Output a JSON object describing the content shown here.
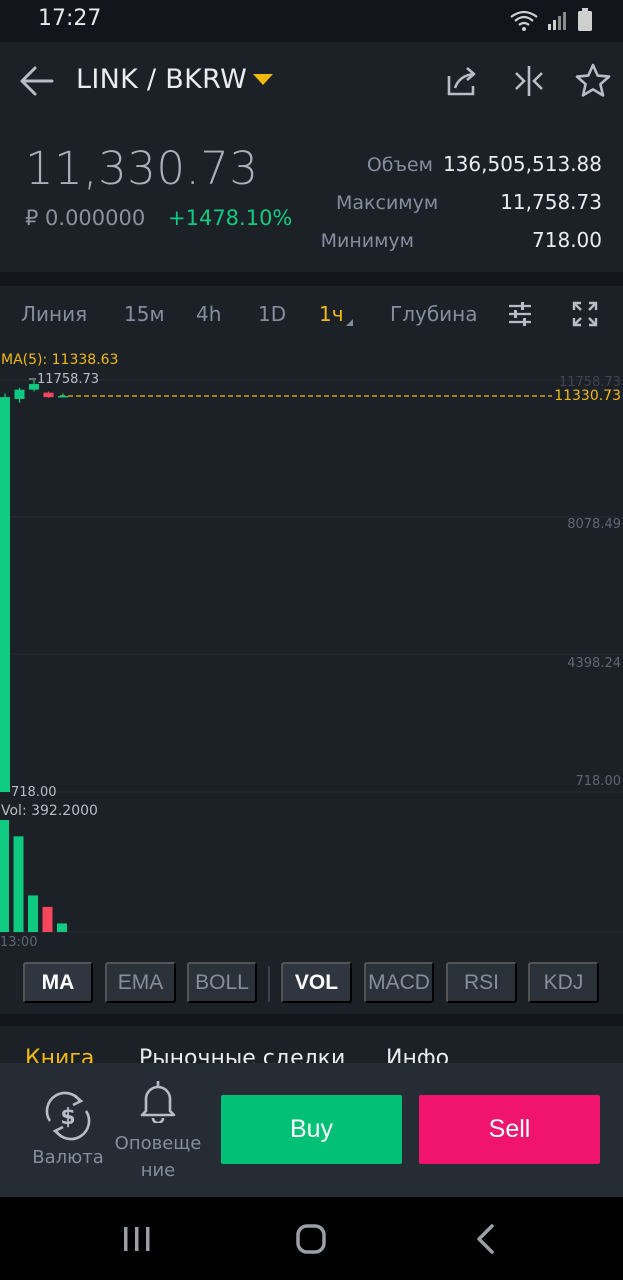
{
  "status_bar": {
    "time": "17:27"
  },
  "header": {
    "pair": "LINK / BKRW"
  },
  "ticker": {
    "last_price": "11,330.73",
    "fiat_price": "₽ 0.000000",
    "change_pct": "+1478.10%",
    "stats": [
      {
        "label": "Объем",
        "value": "136,505,513.88"
      },
      {
        "label": "Максимум",
        "value": "11,758.73"
      },
      {
        "label": "Минимум",
        "value": "718.00"
      }
    ]
  },
  "timeframes": {
    "items": [
      "Линия",
      "15м",
      "4h",
      "1D",
      "1ч",
      "Глубина"
    ],
    "active": "1ч"
  },
  "chart_data": {
    "type": "candlestick",
    "ma_label": "MA(5): 11338.63",
    "vol_label": "Vol: 392.2000",
    "high_label": "11758.73",
    "low_label": "718.00",
    "last_price_label": "11330.73",
    "y_ticks": [
      "11758.73",
      "8078.49",
      "4398.24",
      "718.00"
    ],
    "x_tick": "13:00",
    "ylim": [
      718.0,
      11758.73
    ],
    "colors": {
      "up": "#0ecb81",
      "down": "#f6465d",
      "last_line": "#f0b90b"
    },
    "candles": [
      {
        "open": 718.0,
        "close": 11300.0,
        "high": 11400.0,
        "low": 718.0,
        "dir": "up"
      },
      {
        "open": 11250.0,
        "close": 11500.0,
        "high": 11550.0,
        "low": 11150.0,
        "dir": "up"
      },
      {
        "open": 11500.0,
        "close": 11650.0,
        "high": 11758.73,
        "low": 11450.0,
        "dir": "up"
      },
      {
        "open": 11420.0,
        "close": 11300.0,
        "high": 11450.0,
        "low": 11280.0,
        "dir": "down"
      },
      {
        "open": 11330.73,
        "close": 11330.73,
        "high": 11400.0,
        "low": 11300.0,
        "dir": "up"
      }
    ],
    "volumes": [
      {
        "value": 392.2,
        "dir": "up"
      },
      {
        "value": 335.0,
        "dir": "up"
      },
      {
        "value": 128.0,
        "dir": "up"
      },
      {
        "value": 88.0,
        "dir": "down"
      },
      {
        "value": 30.0,
        "dir": "up"
      }
    ]
  },
  "indicators": {
    "items": [
      "MA",
      "EMA",
      "BOLL",
      "VOL",
      "MACD",
      "RSI",
      "KDJ"
    ],
    "active": [
      "MA",
      "VOL"
    ]
  },
  "tabs": {
    "items": [
      "Книга",
      "Рыночные сделки",
      "Инфо"
    ],
    "active": "Книга"
  },
  "actions": {
    "currency_label": "Валюта",
    "alerts_label_1": "Оповеще",
    "alerts_label_2": "ние",
    "buy_label": "Buy",
    "sell_label": "Sell"
  }
}
